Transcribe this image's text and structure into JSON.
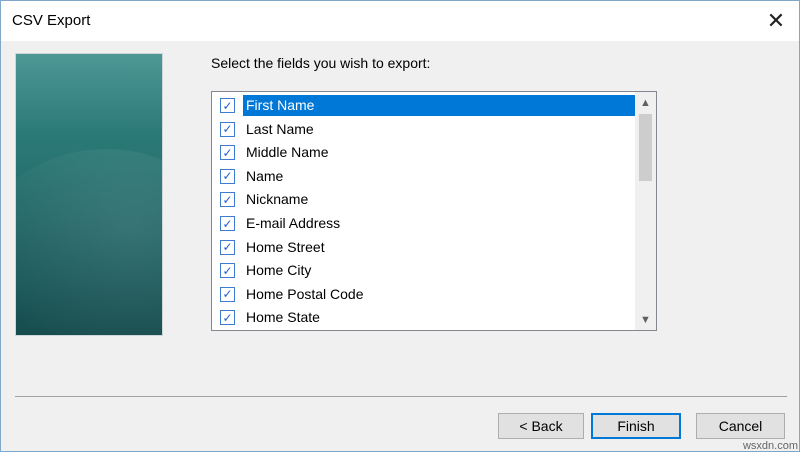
{
  "window": {
    "title": "CSV Export",
    "close_icon": "close-icon",
    "accent": "#0078d7"
  },
  "main": {
    "prompt": "Select the fields you wish to export:",
    "fields": [
      {
        "label": "First Name",
        "checked": true,
        "selected": true
      },
      {
        "label": "Last Name",
        "checked": true,
        "selected": false
      },
      {
        "label": "Middle Name",
        "checked": true,
        "selected": false
      },
      {
        "label": "Name",
        "checked": true,
        "selected": false
      },
      {
        "label": "Nickname",
        "checked": true,
        "selected": false
      },
      {
        "label": "E-mail Address",
        "checked": true,
        "selected": false
      },
      {
        "label": "Home Street",
        "checked": true,
        "selected": false
      },
      {
        "label": "Home City",
        "checked": true,
        "selected": false
      },
      {
        "label": "Home Postal Code",
        "checked": true,
        "selected": false
      },
      {
        "label": "Home State",
        "checked": true,
        "selected": false
      }
    ]
  },
  "buttons": {
    "back": "< Back",
    "finish": "Finish",
    "cancel": "Cancel"
  },
  "watermark": "wsxdn.com"
}
